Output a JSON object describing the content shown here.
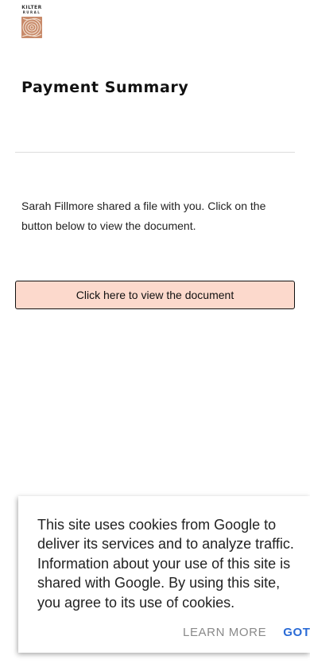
{
  "brand": {
    "logo_line1": "KILTER",
    "logo_line2": "RURAL",
    "art_colors": [
      "#c88a6a",
      "#f2e2d4"
    ]
  },
  "page": {
    "title": "Payment Summary",
    "message": "Sarah Fillmore shared a file with you. Click on the button below to view the document.",
    "cta_label": "Click here to view the document",
    "cta_color": "#fcd9cc"
  },
  "cookie_banner": {
    "text": "This site uses cookies from Google to deliver its services and to analyze traffic. Information about your use of this site is shared with Google. By using this site, you agree to its use of cookies.",
    "learn_more": "LEARN MORE",
    "got_it": "GOT IT",
    "accent_color": "#2a6bd6"
  }
}
